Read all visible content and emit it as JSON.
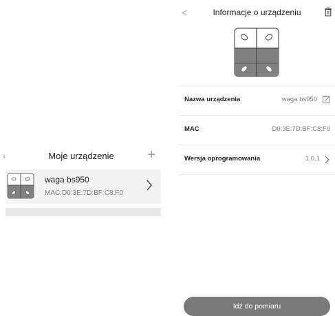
{
  "left": {
    "back_icon": "‹",
    "title": "Moje urządzenie",
    "add_icon": "+",
    "device": {
      "name": "waga bs950",
      "mac": "MAC:D0:3E:7D:BF:C8:F0"
    }
  },
  "right": {
    "back_icon": "<",
    "title": "Informacje o urządzeniu",
    "rows": [
      {
        "label": "Nazwa urządzenia",
        "value": "waga bs950"
      },
      {
        "label": "MAC",
        "value": "D0:3E:7D:BF:C8:F0"
      },
      {
        "label": "Wersja oprogramowania",
        "value": "1.0.1"
      }
    ],
    "measure_button": "Idź do pomiaru"
  },
  "colors": {
    "device_top": "#ffffff",
    "device_bottom": "#808080",
    "row_background": "#f4f4f4",
    "button_background": "#7a7a7a",
    "icon_gray": "#9a9a9a"
  },
  "icons": [
    "back-chevron-icon",
    "plus-icon",
    "scale-icon",
    "chevron-right-icon",
    "trash-icon",
    "edit-icon"
  ]
}
